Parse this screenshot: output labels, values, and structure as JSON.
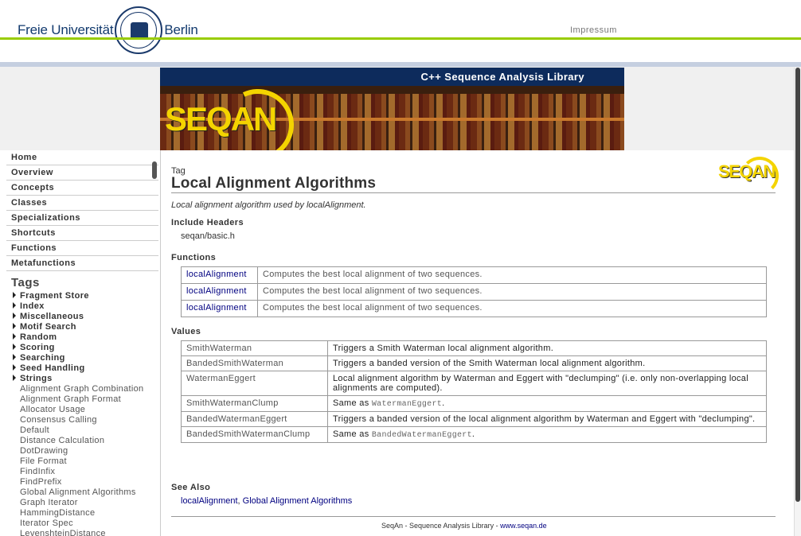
{
  "header": {
    "left_word": "Freie Universität",
    "right_word": "Berlin",
    "impressum": "Impressum"
  },
  "banner": {
    "title": "C++ Sequence Analysis Library",
    "logo": "SEQAN"
  },
  "sidebar": {
    "nav": [
      "Home",
      "Overview",
      "Concepts",
      "Classes",
      "Specializations",
      "Shortcuts",
      "Functions",
      "Metafunctions"
    ],
    "tags_heading": "Tags",
    "tag_groups": [
      "Fragment Store",
      "Index",
      "Miscellaneous",
      "Motif Search",
      "Random",
      "Scoring",
      "Searching",
      "Seed Handling",
      "Strings"
    ],
    "tag_leaves": [
      "Alignment Graph Combination",
      "Alignment Graph Format",
      "Allocator Usage",
      "Consensus Calling",
      "Default",
      "Distance Calculation",
      "DotDrawing",
      "File Format",
      "FindInfix",
      "FindPrefix",
      "Global Alignment Algorithms",
      "Graph Iterator",
      "HammingDistance",
      "Iterator Spec",
      "LevenshteinDistance"
    ]
  },
  "page": {
    "kind": "Tag",
    "title": "Local Alignment Algorithms",
    "logo": "SEQAN",
    "summary": "Local alignment algorithm used by localAlignment.",
    "include_heading": "Include Headers",
    "include_file": "seqan/basic.h",
    "functions_heading": "Functions",
    "functions": [
      {
        "name": "localAlignment",
        "desc": "Computes the best local alignment of two sequences."
      },
      {
        "name": "localAlignment",
        "desc": "Computes the best local alignment of two sequences."
      },
      {
        "name": "localAlignment",
        "desc": "Computes the best local alignment of two sequences."
      }
    ],
    "values_heading": "Values",
    "values": [
      {
        "name": "SmithWaterman",
        "desc": "Triggers a Smith Waterman local alignment algorithm.",
        "code": ""
      },
      {
        "name": "BandedSmithWaterman",
        "desc": "Triggers a banded version of the Smith Waterman local alignment algorithm.",
        "code": ""
      },
      {
        "name": "WatermanEggert",
        "desc": "Local alignment algorithm by Waterman and Eggert with \"declumping\" (i.e. only non-overlapping local alignments are computed).",
        "code": ""
      },
      {
        "name": "SmithWatermanClump",
        "desc": "Same as ",
        "code": "WatermanEggert"
      },
      {
        "name": "BandedWatermanEggert",
        "desc": "Triggers a banded version of the local alignment algorithm by Waterman and Eggert with \"declumping\".",
        "code": ""
      },
      {
        "name": "BandedSmithWatermanClump",
        "desc": "Same as ",
        "code": "BandedWatermanEggert"
      }
    ],
    "see_also_heading": "See Also",
    "see_also": [
      "localAlignment",
      "Global Alignment Algorithms"
    ],
    "footer_text": "SeqAn - Sequence Analysis Library - ",
    "footer_link": "www.seqan.de"
  },
  "colors": {
    "accent_green": "#99cc00",
    "navy": "#0d2b5c",
    "link": "#000080",
    "logo_yellow": "#f4d400"
  }
}
